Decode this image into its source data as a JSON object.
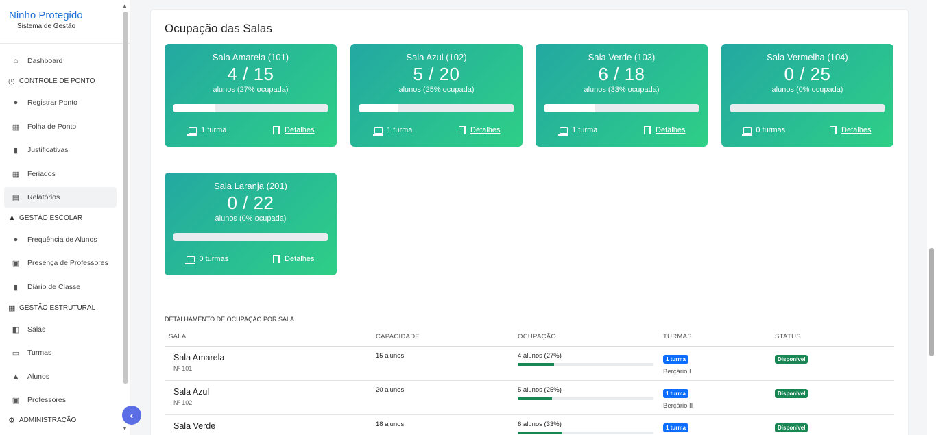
{
  "brand": {
    "title": "Ninho Protegido",
    "subtitle": "Sistema de Gestão"
  },
  "sidebar": {
    "dashboard": "Dashboard",
    "sec_ponto": "CONTROLE DE PONTO",
    "registrar_ponto": "Registrar Ponto",
    "folha_ponto": "Folha de Ponto",
    "justificativas": "Justificativas",
    "feriados": "Feriados",
    "relatorios": "Relatórios",
    "sec_escolar": "GESTÃO ESCOLAR",
    "frequencia": "Frequência de Alunos",
    "presenca": "Presença de Professores",
    "diario": "Diário de Classe",
    "sec_estrutural": "GESTÃO ESTRUTURAL",
    "salas": "Salas",
    "turmas": "Turmas",
    "alunos": "Alunos",
    "professores": "Professores",
    "sec_admin": "ADMINISTRAÇÃO"
  },
  "main": {
    "title": "Ocupação das Salas",
    "cards": [
      {
        "name": "Sala Amarela (101)",
        "count": "4 / 15",
        "pct": "alunos (27% ocupada)",
        "fill": 0.27,
        "turmas": "1 turma",
        "details": "Detalhes"
      },
      {
        "name": "Sala Azul (102)",
        "count": "5 / 20",
        "pct": "alunos (25% ocupada)",
        "fill": 0.25,
        "turmas": "1 turma",
        "details": "Detalhes"
      },
      {
        "name": "Sala Verde (103)",
        "count": "6 / 18",
        "pct": "alunos (33% ocupada)",
        "fill": 0.33,
        "turmas": "1 turma",
        "details": "Detalhes"
      },
      {
        "name": "Sala Vermelha (104)",
        "count": "0 / 25",
        "pct": "alunos (0% ocupada)",
        "fill": 0,
        "turmas": "0 turmas",
        "details": "Detalhes"
      },
      {
        "name": "Sala Laranja (201)",
        "count": "0 / 22",
        "pct": "alunos (0% ocupada)",
        "fill": 0,
        "turmas": "0 turmas",
        "details": "Detalhes"
      }
    ],
    "table": {
      "caption": "DETALHAMENTO DE OCUPAÇÃO POR SALA",
      "headers": [
        "SALA",
        "CAPACIDADE",
        "OCUPAÇÃO",
        "TURMAS",
        "STATUS"
      ],
      "rows": [
        {
          "sala": "Sala Amarela",
          "num": "Nº 101",
          "capacidade": "15 alunos",
          "ocupacao": "4 alunos (27%)",
          "fill": 0.27,
          "turmas_badge": "1 turma",
          "turma_name": "Berçário I",
          "status": "Disponível"
        },
        {
          "sala": "Sala Azul",
          "num": "Nº 102",
          "capacidade": "20 alunos",
          "ocupacao": "5 alunos (25%)",
          "fill": 0.25,
          "turmas_badge": "1 turma",
          "turma_name": "Berçário II",
          "status": "Disponível"
        },
        {
          "sala": "Sala Verde",
          "num": "",
          "capacidade": "18 alunos",
          "ocupacao": "6 alunos (33%)",
          "fill": 0.33,
          "turmas_badge": "1 turma",
          "turma_name": "",
          "status": "Disponível"
        }
      ]
    }
  },
  "colors": {
    "accent": "#1f73d8",
    "card_start": "#23a8a2",
    "card_end": "#2ecf86",
    "badge_blue": "#0d6efd",
    "badge_green": "#198754",
    "collapse": "#5b6ee6"
  },
  "icons": {
    "collapse": "chevron-left-icon"
  }
}
